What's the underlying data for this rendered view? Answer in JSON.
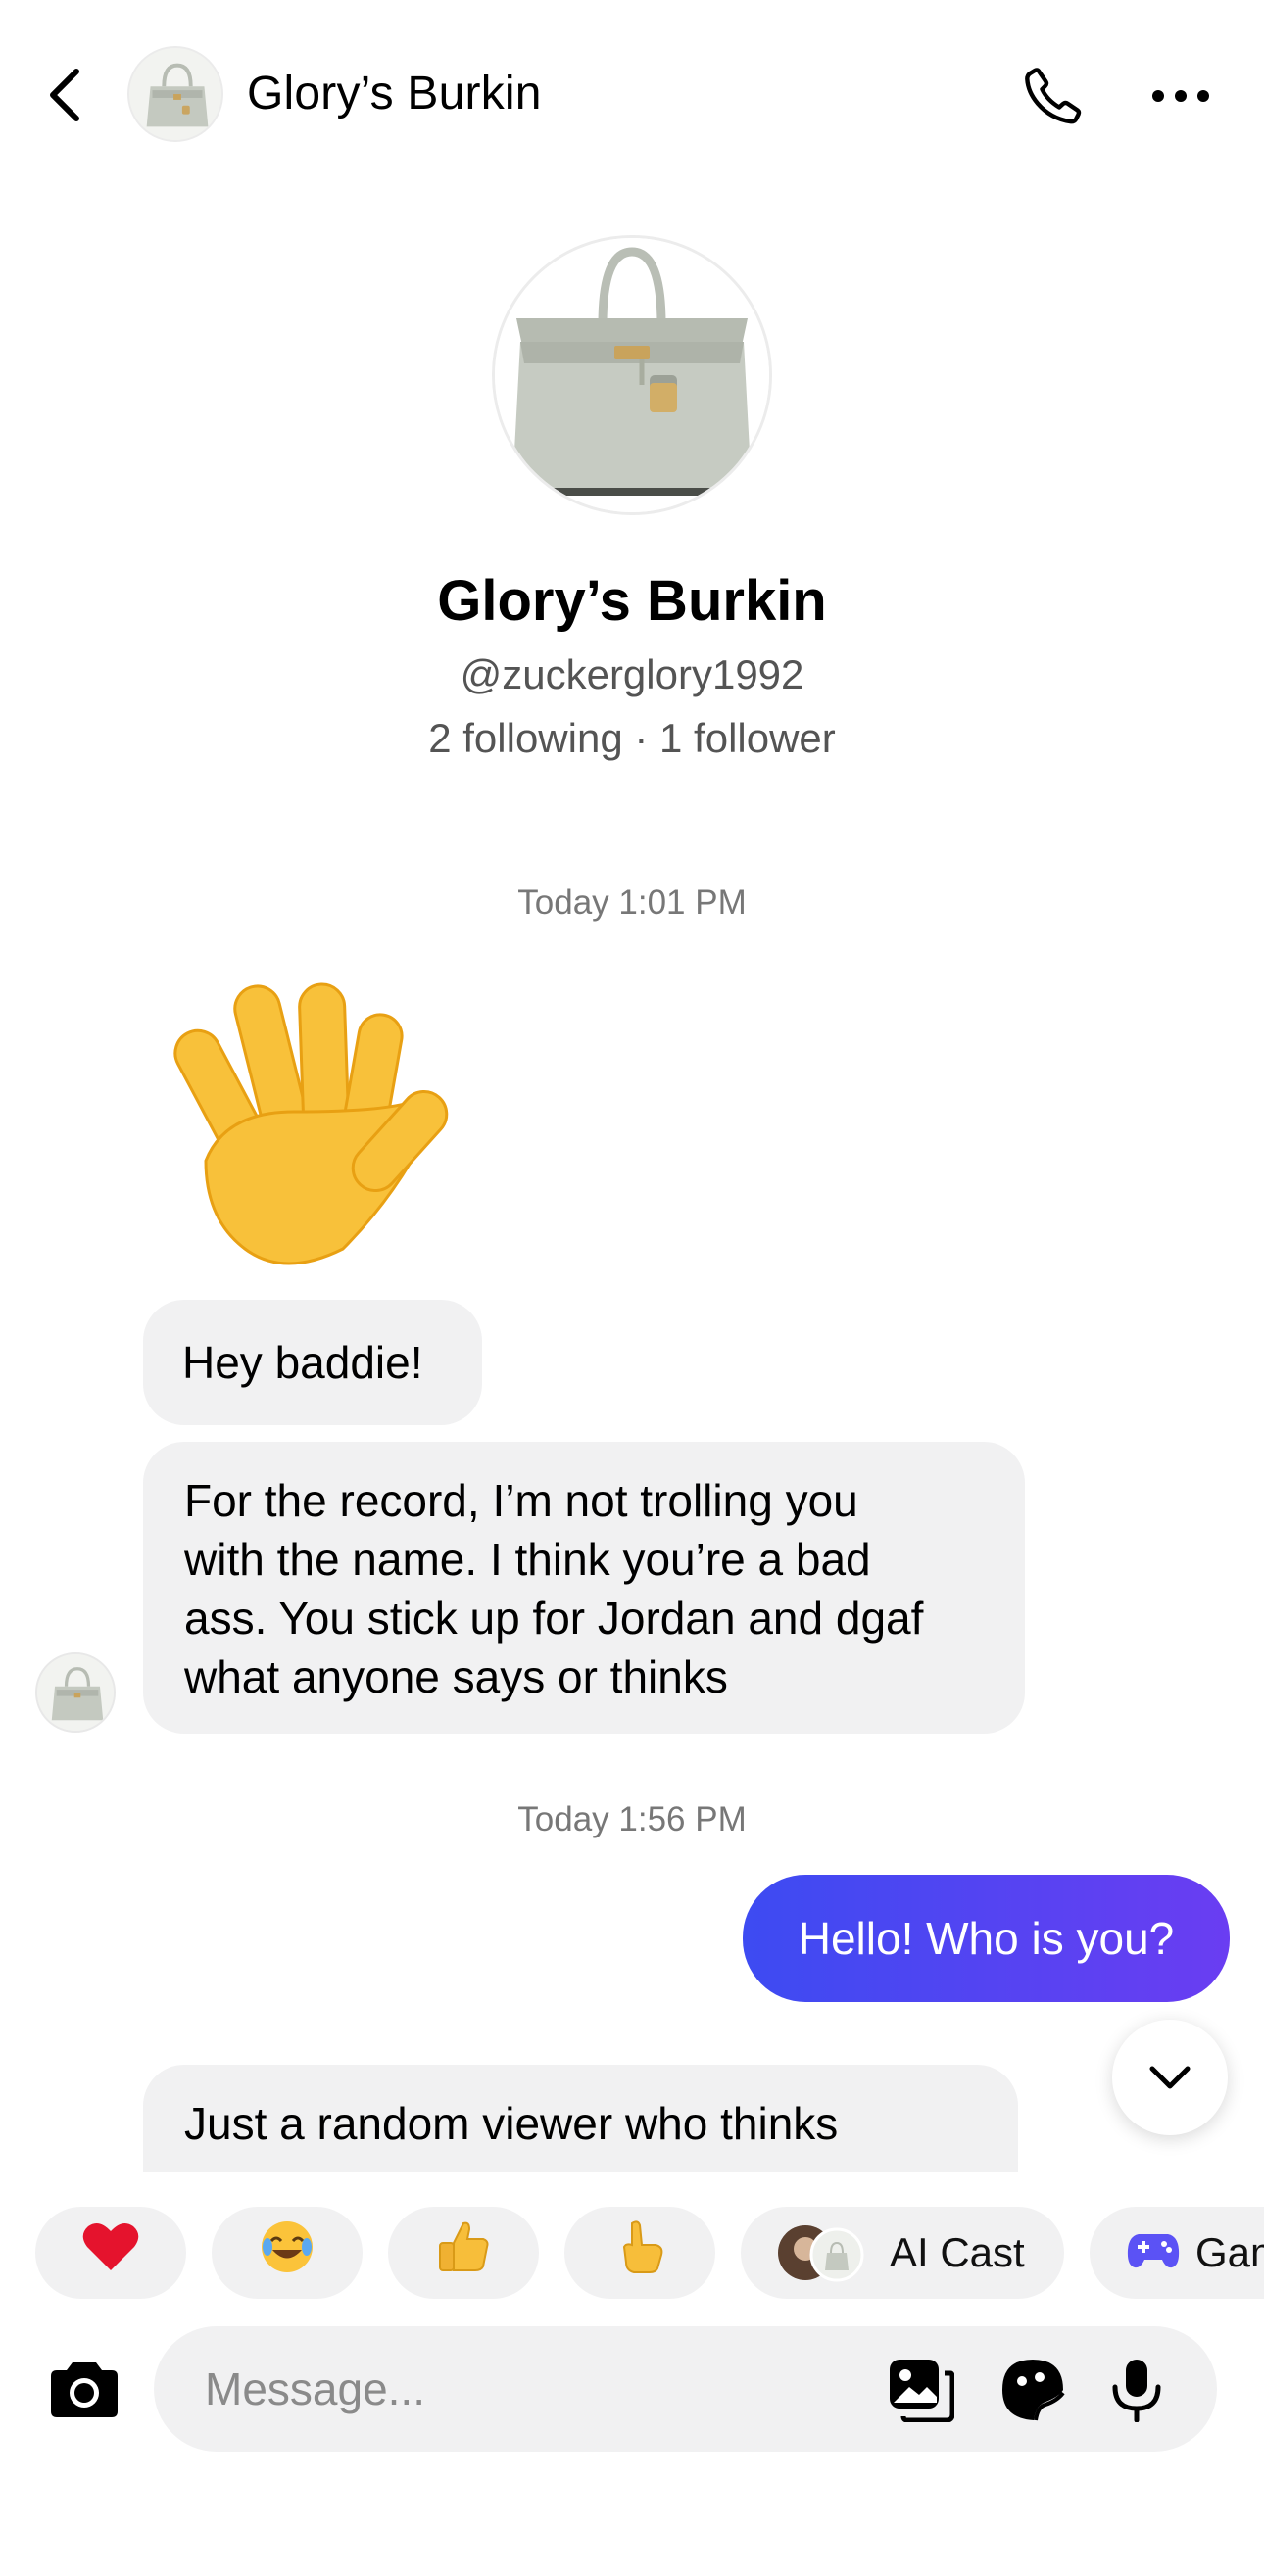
{
  "header": {
    "title": "Glory’s Burkin",
    "back_icon": "chevron-left-icon",
    "call_icon": "phone-icon",
    "more_icon": "more-dots-icon"
  },
  "profile": {
    "name": "Glory’s Burkin",
    "handle": "@zuckerglory1992",
    "stats": "2 following · 1 follower"
  },
  "messages": [
    {
      "type": "timestamp",
      "text": "Today 1:01 PM"
    },
    {
      "type": "sticker",
      "icon": "waving-hand-emoji"
    },
    {
      "type": "incoming",
      "text": "Hey baddie!"
    },
    {
      "type": "incoming",
      "lines": [
        "For the record, I’m not trolling you",
        "with the name. I think you’re a bad",
        "ass. You stick up for Jordan and dgaf",
        "what anyone says or thinks"
      ]
    },
    {
      "type": "timestamp",
      "text": "Today 1:56 PM"
    },
    {
      "type": "outgoing",
      "text": "Hello! Who is you?"
    },
    {
      "type": "incoming",
      "text": "Just a random viewer who thinks"
    }
  ],
  "quick_replies": [
    {
      "emoji": "❤️",
      "icon": "heart-emoji"
    },
    {
      "emoji": "😂",
      "icon": "laughing-emoji"
    },
    {
      "emoji": "👍",
      "icon": "thumbs-up-emoji"
    },
    {
      "emoji": "👆",
      "icon": "pointing-emoji"
    },
    {
      "label": "AI Cast",
      "icon": "ai-cast-avatars"
    },
    {
      "label": "Gam",
      "icon": "game-controller-icon"
    }
  ],
  "composer": {
    "placeholder": "Message...",
    "camera_icon": "camera-icon",
    "gallery_icon": "gallery-icon",
    "sticker_icon": "sticker-icon",
    "mic_icon": "microphone-icon"
  },
  "colors": {
    "outgoing_start": "#3d4bf2",
    "outgoing_end": "#6a3df2",
    "incoming_bg": "#f1f1f2",
    "game_icon": "#5b52f5"
  }
}
